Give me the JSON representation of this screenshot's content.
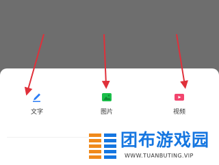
{
  "options": [
    {
      "label": "文字",
      "icon": "pen-icon",
      "color": "#2b7cf6"
    },
    {
      "label": "图片",
      "icon": "image-icon",
      "color": "#1bbf4a"
    },
    {
      "label": "视频",
      "icon": "video-icon",
      "color": "#f2456e"
    }
  ],
  "watermark": {
    "title": "团布游戏园",
    "url": "WWW.TUANBUTING.VIP",
    "logo_colors": [
      "#f08a1c",
      "#1576e0"
    ]
  },
  "arrow_color": "#e0303a"
}
